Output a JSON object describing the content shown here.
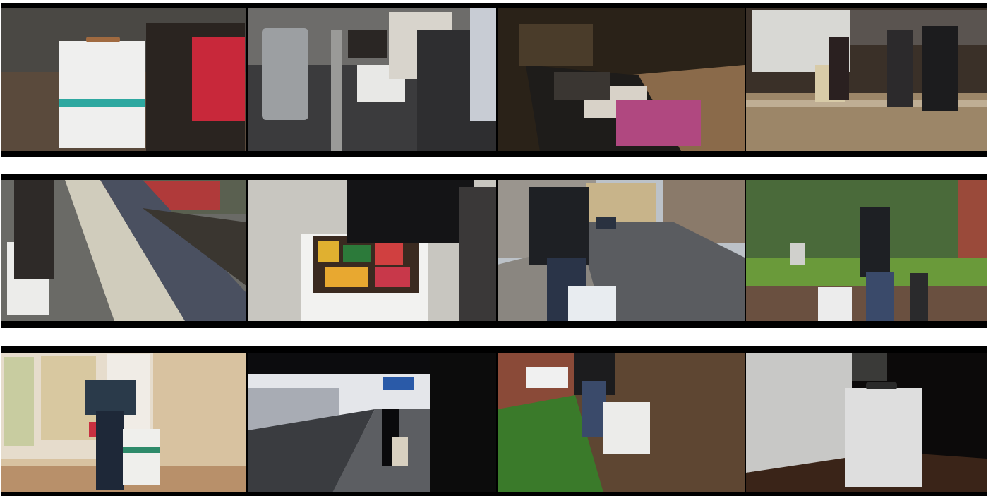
{
  "rows": [
    {
      "frames": [
        {
          "scene": "suitcase-with-strap-indoors"
        },
        {
          "scene": "suitcase-on-security-conveyor"
        },
        {
          "scene": "suitcase-on-baggage-carousel"
        },
        {
          "scene": "travelers-at-baggage-claim"
        }
      ]
    },
    {
      "frames": [
        {
          "scene": "suitcase-on-train-platform"
        },
        {
          "scene": "suitcase-opened-with-snacks"
        },
        {
          "scene": "suitcase-pulled-on-cobblestone-street"
        },
        {
          "scene": "suitcase-pulled-in-park"
        }
      ]
    },
    {
      "frames": [
        {
          "scene": "person-with-suitcase-at-map-board"
        },
        {
          "scene": "person-on-station-platform"
        },
        {
          "scene": "suitcase-pulled-on-dirt-path"
        },
        {
          "scene": "suitcase-standing-in-dark-room"
        }
      ]
    }
  ],
  "colors": {
    "film_black": "#000000",
    "suitcase_white": "#eeeeee",
    "strap_teal": "#2ea8a0"
  }
}
